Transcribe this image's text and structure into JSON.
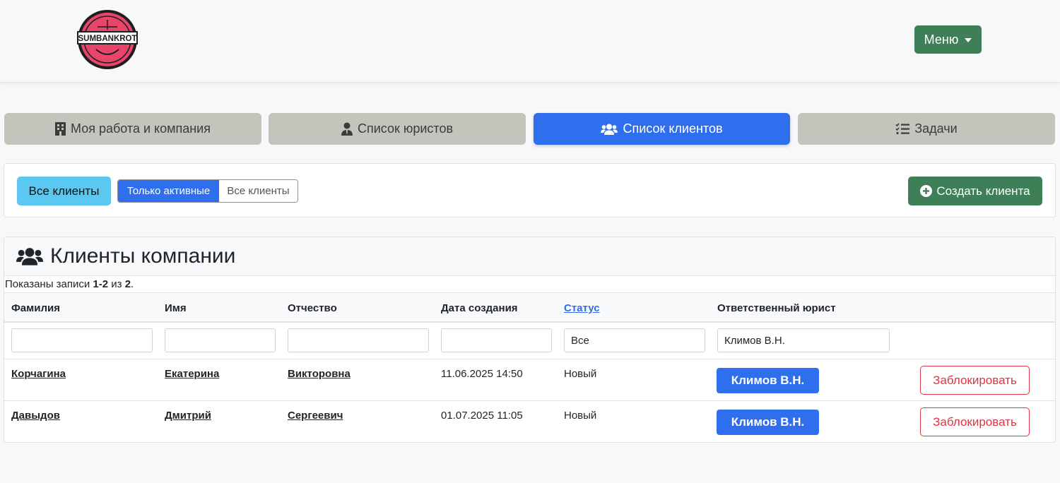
{
  "navbar": {
    "logo_text": "SUMBANKROT",
    "menu_label": "Меню"
  },
  "tabs": [
    {
      "label": "Моя работа и компания",
      "icon": "building-icon",
      "active": false
    },
    {
      "label": "Список юристов",
      "icon": "user-tie-icon",
      "active": false
    },
    {
      "label": "Список клиентов",
      "icon": "users-icon",
      "active": true
    },
    {
      "label": "Задачи",
      "icon": "tasks-list-icon",
      "active": false
    }
  ],
  "filters": {
    "badge_label": "Все клиенты",
    "toggle_active_label": "Только активные",
    "toggle_all_label": "Все клиенты",
    "create_label": "Создать клиента"
  },
  "table": {
    "title": "Клиенты компании",
    "summary": {
      "prefix": "Показаны записи ",
      "range": "1-2",
      "mid": " из ",
      "total": "2",
      "suffix": "."
    },
    "columns": [
      "Фамилия",
      "Имя",
      "Отчество",
      "Дата создания",
      "Статус",
      "Ответственный юрист"
    ],
    "filter_values": {
      "surname": "",
      "name": "",
      "patronymic": "",
      "created": "",
      "status": "Все",
      "lawyer": "Климов В.Н."
    },
    "rows": [
      {
        "surname": "Корчагина",
        "name": "Екатерина",
        "patronymic": "Викторовна",
        "created": "11.06.2025 14:50",
        "status": "Новый",
        "lawyer": "Климов В.Н.",
        "action": "Заблокировать"
      },
      {
        "surname": "Давыдов",
        "name": "Дмитрий",
        "patronymic": "Сергеевич",
        "created": "01.07.2025 11:05",
        "status": "Новый",
        "lawyer": "Климов В.Н.",
        "action": "Заблокировать"
      }
    ]
  },
  "colors": {
    "primary": "#2f6fed",
    "success": "#3f7f57",
    "info": "#5cc8ef",
    "danger": "#dc3545",
    "tab_inactive": "#c4c4bd"
  }
}
